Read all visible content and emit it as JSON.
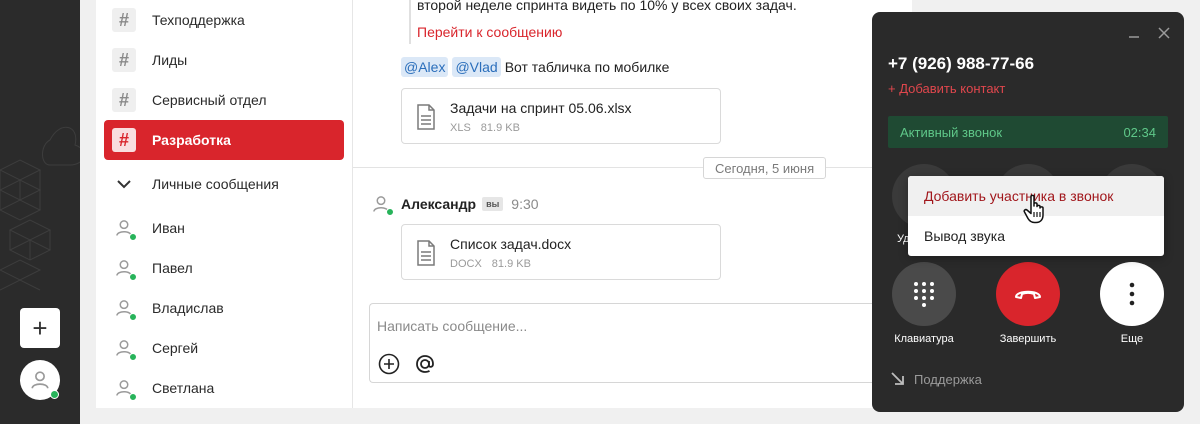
{
  "rail": {
    "add_label": "+"
  },
  "channels": [
    {
      "type": "channel",
      "label": "Техподдержка"
    },
    {
      "type": "channel",
      "label": "Лиды"
    },
    {
      "type": "channel",
      "label": "Сервисный отдел"
    },
    {
      "type": "channel",
      "label": "Разработка",
      "active": true
    },
    {
      "type": "section",
      "label": "Личные сообщения"
    },
    {
      "type": "user",
      "label": "Иван"
    },
    {
      "type": "user",
      "label": "Павел"
    },
    {
      "type": "user",
      "label": "Владислав"
    },
    {
      "type": "user",
      "label": "Сергей"
    },
    {
      "type": "user",
      "label": "Светлана"
    }
  ],
  "chat": {
    "quote_text": "второй неделе спринта видеть по 10% у всех своих задач.",
    "quote_link": "Перейти к сообщению",
    "mentions": [
      "@Alex",
      "@Vlad"
    ],
    "mention_message": "Вот табличка по мобилке",
    "file1": {
      "name": "Задачи на спринт 05.06.xlsx",
      "ext": "XLS",
      "size": "81.9 KB"
    },
    "date_divider": "Сегодня, 5 июня",
    "message": {
      "author": "Александр",
      "badge": "вы",
      "time": "9:30"
    },
    "file2": {
      "name": "Список задач.docx",
      "ext": "DOCX",
      "size": "81.9 KB"
    },
    "composer_placeholder": "Написать сообщение..."
  },
  "call": {
    "phone": "+7 (926) 988-77-66",
    "add_contact": "+ Добавить контакт",
    "status": "Активный звонок",
    "duration": "02:34",
    "hidden_label_fragment": "Уд",
    "buttons": {
      "keypad": "Клавиатура",
      "end": "Завершить",
      "more": "Еще"
    },
    "support": "Поддержка",
    "colors": {
      "end": "#d9252c",
      "status_bg": "#1f4a33",
      "status_text": "#5fc889"
    }
  },
  "menu": {
    "items": [
      "Добавить участника в звонок",
      "Вывод звука"
    ]
  }
}
